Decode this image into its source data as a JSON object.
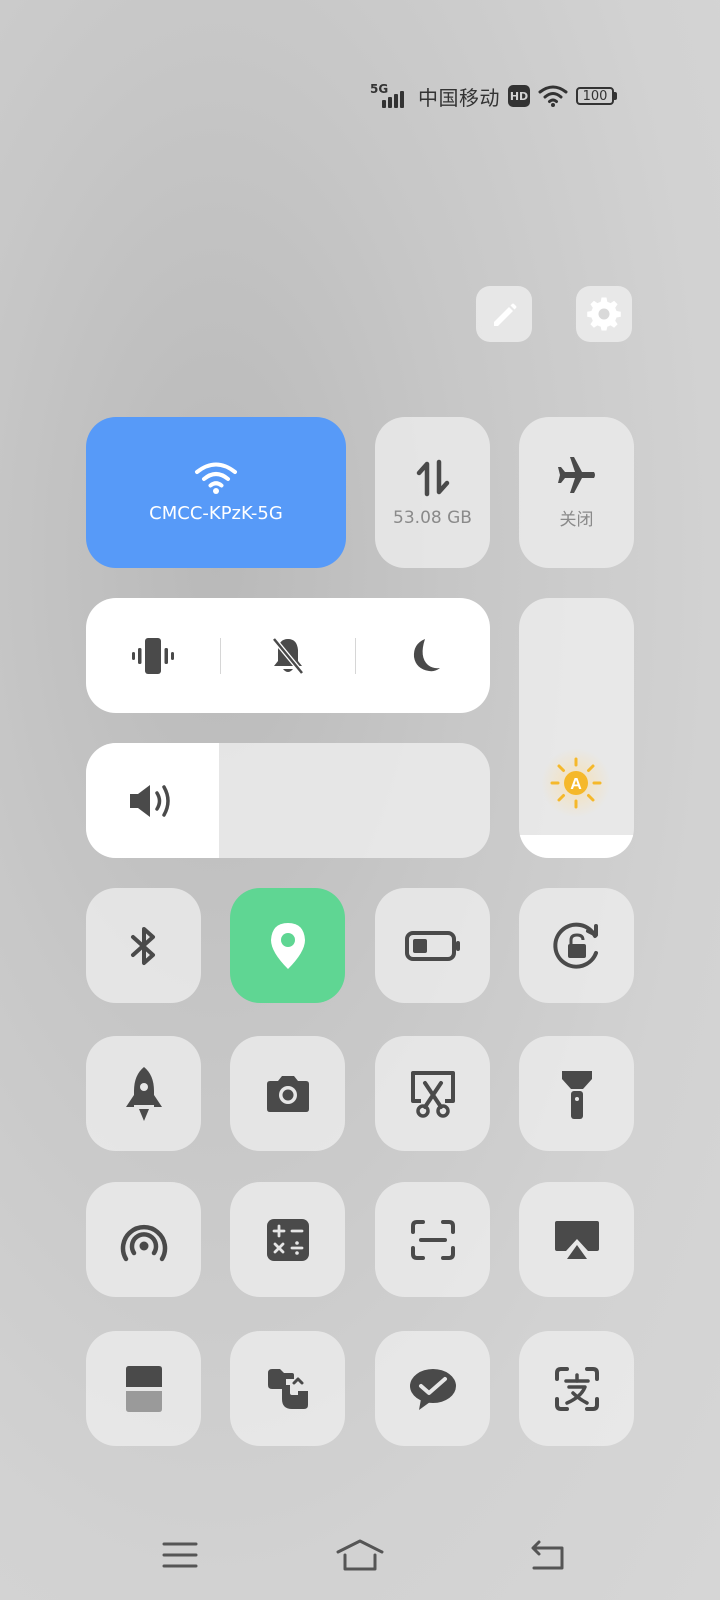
{
  "status_bar": {
    "network": "5G",
    "carrier": "中国移动",
    "hd": "HD",
    "battery": "100"
  },
  "top_actions": {
    "edit_icon": "pencil-icon",
    "settings_icon": "gear-icon"
  },
  "tiles": {
    "wifi": {
      "label": "CMCC-KPzK-5G",
      "icon": "wifi-icon",
      "active": true
    },
    "data": {
      "label": "53.08 GB",
      "icon": "data-transfer-icon",
      "active": false
    },
    "airplane": {
      "label": "关闭",
      "icon": "airplane-icon",
      "active": false
    }
  },
  "sound_modes": [
    "vibrate-icon",
    "mute-icon",
    "do-not-disturb-icon"
  ],
  "sliders": {
    "volume_level": 0.33,
    "brightness_level": 0.09,
    "brightness_auto_label": "A"
  },
  "grid_tiles": [
    {
      "name": "bluetooth",
      "icon": "bluetooth-icon",
      "active": false
    },
    {
      "name": "location",
      "icon": "location-icon",
      "active": true
    },
    {
      "name": "battery-saver",
      "icon": "battery-icon",
      "active": false
    },
    {
      "name": "rotation-lock",
      "icon": "rotation-lock-icon",
      "active": false
    },
    {
      "name": "game-boost",
      "icon": "rocket-icon",
      "active": false
    },
    {
      "name": "camera",
      "icon": "camera-icon",
      "active": false
    },
    {
      "name": "screenshot",
      "icon": "screenshot-icon",
      "active": false
    },
    {
      "name": "flashlight",
      "icon": "flashlight-icon",
      "active": false
    },
    {
      "name": "hotspot",
      "icon": "hotspot-icon",
      "active": false
    },
    {
      "name": "calculator",
      "icon": "calculator-icon",
      "active": false
    },
    {
      "name": "scan",
      "icon": "scan-icon",
      "active": false
    },
    {
      "name": "screen-cast",
      "icon": "cast-icon",
      "active": false
    },
    {
      "name": "split-screen",
      "icon": "split-screen-icon",
      "active": false
    },
    {
      "name": "transfer",
      "icon": "transfer-icon",
      "active": false
    },
    {
      "name": "wechat",
      "icon": "chat-icon",
      "active": false
    },
    {
      "name": "translate",
      "icon": "translate-icon",
      "active": false
    }
  ],
  "colors": {
    "wifi_active": "#579af8",
    "location_active": "#5fd693",
    "icon_dark": "#4a4a4a"
  },
  "nav": [
    "menu-icon",
    "home-icon",
    "back-icon"
  ]
}
